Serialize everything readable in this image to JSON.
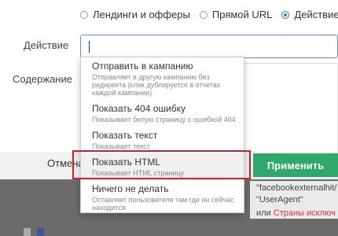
{
  "radio_options": [
    {
      "label": "Лендинги и офферы",
      "checked": false
    },
    {
      "label": "Прямой URL",
      "checked": false
    },
    {
      "label": "Действие",
      "checked": true
    }
  ],
  "labels": {
    "action": "Действие",
    "content": "Содержание"
  },
  "dropdown": {
    "items": [
      {
        "title": "Отправить в кампанию",
        "desc": "Отправляет в другую кампанию без редиректа (клик дублируется в отчетах каждой кампании)"
      },
      {
        "title": "Показать 404 ошибку",
        "desc": "Показывает белую страницу с ошибкой 404"
      },
      {
        "title": "Показать текст",
        "desc": "Показывает текст"
      },
      {
        "title": "Показать HTML",
        "desc": "Показывает HTML страницу"
      },
      {
        "title": "Ничего не делать",
        "desc": "Оставляет пользователя там где он сейчас находится"
      }
    ]
  },
  "buttons": {
    "cancel": "Отмена",
    "apply": "Применить"
  },
  "background": {
    "line1": "\"facebookexternalhit/",
    "line2": "\"UserAgent\"",
    "line3_prefix": "или",
    "line3_red": "Страны исключ"
  },
  "colors": {
    "accent": "#2e7fd6",
    "apply_bg": "#2fa96b",
    "highlight": "#d42020"
  }
}
